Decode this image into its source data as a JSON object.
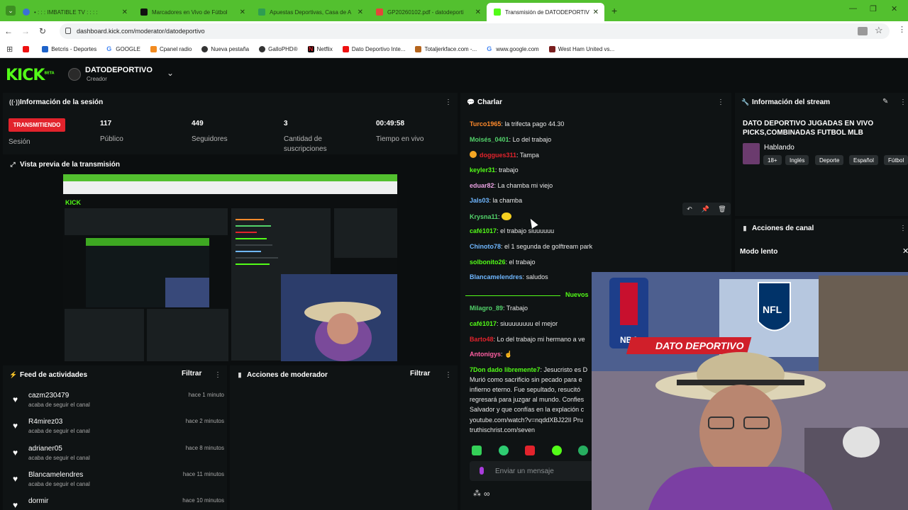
{
  "browser": {
    "tabs": [
      {
        "title": "• : : : IMBATIBLE TV : : : :",
        "color": "#3b6fd6"
      },
      {
        "title": "Marcadores en Vivo de Fútbol",
        "color": "#111111"
      },
      {
        "title": "Apuestas Deportivas, Casa de A",
        "color": "#2e9d52"
      },
      {
        "title": "GP20260102.pdf - datodeporti",
        "color": "#e3463a"
      },
      {
        "title": "Transmisión de DATODEPORTIV",
        "color": "#53fc18"
      }
    ],
    "url": "dashboard.kick.com/moderator/datodeportivo",
    "bookmarks": [
      {
        "label": "",
        "color": "#e11"
      },
      {
        "label": "Betcris - Deportes",
        "color": "#1e63c9"
      },
      {
        "label": "GOOGLE",
        "color": "#e2342a"
      },
      {
        "label": "Cpanel radio",
        "color": "#f28b20"
      },
      {
        "label": "Nueva pestaña",
        "color": "#333"
      },
      {
        "label": "GalloPHD®",
        "color": "#333"
      },
      {
        "label": "Netflix",
        "color": "#d81f26"
      },
      {
        "label": "Dato Deportivo Inte...",
        "color": "#e11"
      },
      {
        "label": "Totaljerkface.com -...",
        "color": "#b5651d"
      },
      {
        "label": "www.google.com",
        "color": "#4285f4"
      },
      {
        "label": "West Ham United vs...",
        "color": "#7a1e1e"
      }
    ]
  },
  "header": {
    "logo": "KICK",
    "logo_tag": "BETA",
    "channel_name": "DATODEPORTIVO",
    "channel_role": "Creador"
  },
  "session": {
    "title": "Información de la sesión",
    "live_label": "TRANSMITIENDO",
    "session_label": "Sesión",
    "viewers": "117",
    "viewers_label": "Público",
    "followers": "449",
    "followers_label": "Seguidores",
    "subs": "3",
    "subs_label": "Cantidad de suscripciones",
    "uptime": "00:49:58",
    "uptime_label": "Tiempo en vivo"
  },
  "preview": {
    "title": "Vista previa de la transmisión"
  },
  "feed": {
    "title": "Feed de actividades",
    "filter": "Filtrar",
    "items": [
      {
        "name": "cazm230479",
        "sub": "acaba de seguir el canal",
        "time": "hace 1 minuto"
      },
      {
        "name": "R4mirez03",
        "sub": "acaba de seguir el canal",
        "time": "hace 2 minutos"
      },
      {
        "name": "adrianer05",
        "sub": "acaba de seguir el canal",
        "time": "hace 8 minutos"
      },
      {
        "name": "Blancamelendres",
        "sub": "acaba de seguir el canal",
        "time": "hace 11 minutos"
      },
      {
        "name": "dormir",
        "sub": "",
        "time": "hace 10 minutos"
      }
    ]
  },
  "mod_actions": {
    "title": "Acciones de moderador",
    "filter": "Filtrar"
  },
  "chat": {
    "title": "Charlar",
    "messages": [
      {
        "user": "Turco1965",
        "color": "#ff8a2b",
        "text": "la trifecta pago 44.30"
      },
      {
        "user": "Moisés_0401",
        "color": "#53d36b",
        "text": "Lo del trabajo"
      },
      {
        "user": "doggues311",
        "color": "#e2232c",
        "text": "Tampa"
      },
      {
        "user": "keyler31",
        "color": "#53fc18",
        "text": "trabajo"
      },
      {
        "user": "eduar82",
        "color": "#e8a0e0",
        "text": "La chamba mi viejo"
      },
      {
        "user": "Jals03",
        "color": "#6fb7ff",
        "text": "la chamba"
      },
      {
        "user": "Krysna11",
        "color": "#53d36b",
        "text": ""
      },
      {
        "user": "café1017",
        "color": "#53fc18",
        "text": "el trabajo siuuuuuu"
      },
      {
        "user": "Chinoto78",
        "color": "#6fb7ff",
        "text": "el 1 segunda de golftream park"
      },
      {
        "user": "solbonito26",
        "color": "#53fc18",
        "text": "el trabajo"
      },
      {
        "user": "Blancamelendres",
        "color": "#6fb7ff",
        "text": "saludos"
      }
    ],
    "new_label": "Nuevos",
    "new_messages": [
      {
        "user": "Milagro_89",
        "color": "#53d36b",
        "text": "Trabajo"
      },
      {
        "user": "café1017",
        "color": "#53fc18",
        "text": "siuuuuuuuu el mejor"
      },
      {
        "user": "Barto48",
        "color": "#e2232c",
        "text": "Lo del trabajo mi hermano a ve"
      },
      {
        "user": "Antonigys",
        "color": "#ff5fa2",
        "text": ""
      }
    ],
    "long_user": "7Don dado libremente7",
    "long_lines": [
      "Jesucristo es D",
      "Murió como sacrificio sin pecado para e",
      "infierno eterno. Fue sepultado, resucitó",
      "regresará para juzgar al mundo. Confies",
      "Salvador y que confías en la explación c",
      "youtube.com/watch?v=nqddXBJ22lI Pru",
      "truthischrist.com/seven"
    ],
    "input_placeholder": "Enviar un mensaje",
    "emote_colors": [
      "#34d058",
      "#2ecc71",
      "#e2232c",
      "#53fc18",
      "#27ae60"
    ]
  },
  "stream_info": {
    "title": "Información del stream",
    "stream_title_line1": "DATO DEPORTIVO JUGADAS EN VIVO",
    "stream_title_line2": "PICKS,COMBINADAS FUTBOL MLB",
    "category": "Hablando",
    "tags": [
      "18+",
      "Inglés",
      "Deporte",
      "Español",
      "Fútbol"
    ]
  },
  "channel_actions": {
    "title": "Acciones de canal",
    "slow_mode": "Modo lento"
  },
  "webcam": {
    "overlay_text": "DATO DEPORTIVO",
    "league_1": "NBA",
    "league_2": "NFL"
  }
}
